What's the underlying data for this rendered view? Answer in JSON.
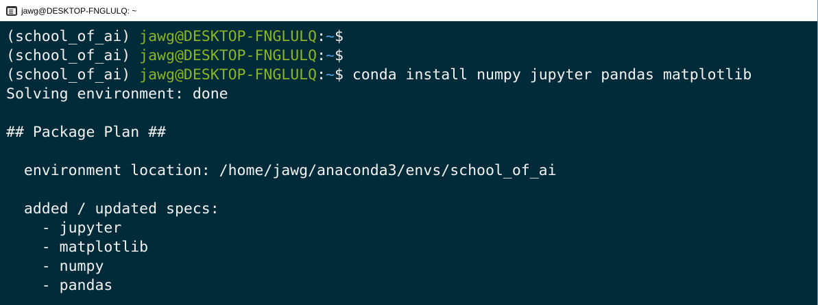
{
  "window": {
    "title": "jawg@DESKTOP-FNGLULQ: ~",
    "colors": {
      "terminal_background": "#022b3a",
      "text": "#f2f2f2",
      "prompt_user": "#8ab524",
      "prompt_path": "#4d9be0"
    }
  },
  "prompts": [
    {
      "env": "(school_of_ai) ",
      "user_host": "jawg@DESKTOP-FNGLULQ",
      "colon": ":",
      "path": "~",
      "symbol": "$",
      "command": ""
    },
    {
      "env": "(school_of_ai) ",
      "user_host": "jawg@DESKTOP-FNGLULQ",
      "colon": ":",
      "path": "~",
      "symbol": "$",
      "command": ""
    },
    {
      "env": "(school_of_ai) ",
      "user_host": "jawg@DESKTOP-FNGLULQ",
      "colon": ":",
      "path": "~",
      "symbol": "$",
      "command": " conda install numpy jupyter pandas matplotlib"
    }
  ],
  "output": [
    "Solving environment: done",
    "",
    "## Package Plan ##",
    "",
    "  environment location: /home/jawg/anaconda3/envs/school_of_ai",
    "",
    "  added / updated specs:",
    "    - jupyter",
    "    - matplotlib",
    "    - numpy",
    "    - pandas"
  ]
}
